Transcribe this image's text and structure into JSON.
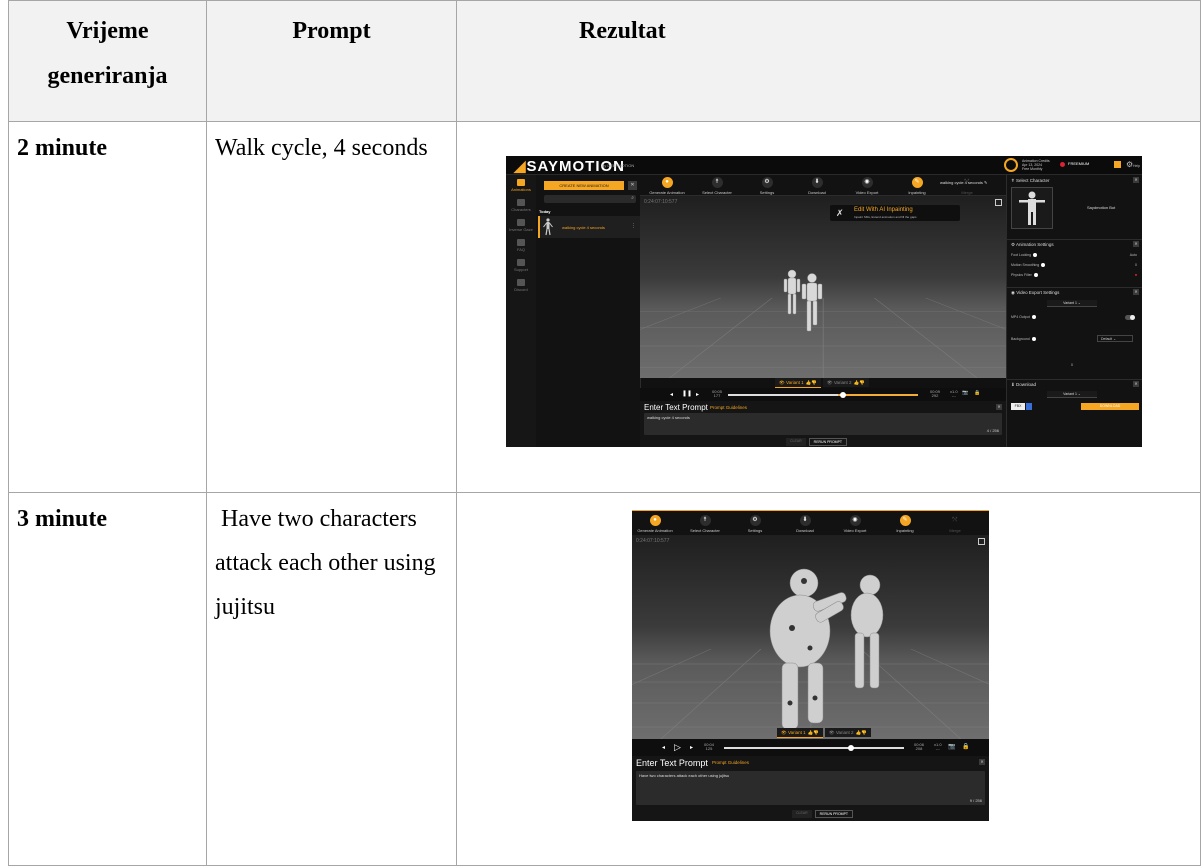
{
  "table": {
    "headers": {
      "col1_line1": "Vrijeme",
      "col1_line2": "generiranja",
      "col2": "Prompt",
      "col3": "Rezultat"
    },
    "rows": [
      {
        "time": "2 minute",
        "prompt": "Walk cycle, 4 seconds"
      },
      {
        "time": "3 minute",
        "prompt": " Have two characters attack each other using jujitsu"
      }
    ]
  },
  "shot1": {
    "logo": "SAYMOTION",
    "logo_by": "by DEEPMOTION",
    "credits": {
      "label": "Animation Credits",
      "renew": "Apr 13, 2024",
      "period": "Free Monthly",
      "plan": "FREEMIUM",
      "help": "Help"
    },
    "rail": [
      {
        "label": "Animations",
        "icon": "plus-icon",
        "active": true
      },
      {
        "label": "Characters",
        "icon": "person-icon",
        "active": false
      },
      {
        "label": "Inverse Gaze",
        "icon": "gamepad-icon",
        "active": false
      },
      {
        "label": "FAQ",
        "icon": "book-icon",
        "active": false
      },
      {
        "label": "Support",
        "icon": "gear-icon",
        "active": false
      },
      {
        "label": "Discord",
        "icon": "chat-icon",
        "active": false
      }
    ],
    "create_new": "CREATE NEW ANIMATION",
    "today": "Today",
    "history_item": "walking cycle 4 seconds",
    "toolbar": [
      {
        "label": "Generate Animation",
        "icon": "lightbulb-icon",
        "state": "hl"
      },
      {
        "label": "Select Character",
        "icon": "figure-icon",
        "state": "normal"
      },
      {
        "label": "Settings",
        "icon": "gear-icon",
        "state": "normal"
      },
      {
        "label": "Download",
        "icon": "download-icon",
        "state": "normal"
      },
      {
        "label": "Video Export",
        "icon": "record-icon",
        "state": "normal"
      },
      {
        "label": "Inpainting",
        "icon": "inpaint-icon",
        "state": "hl"
      },
      {
        "label": "Merge",
        "icon": "merge-icon",
        "state": "dim"
      }
    ],
    "title": "walking cycle 4 seconds",
    "timestamp": "0:24:07:10:577",
    "banner_title": "Edit With AI Inpainting",
    "banner_sub": "Inpaint SMs, Extend animation and fill the gaps",
    "variant1": "Variant 1",
    "variant2": "Variant 2",
    "time_cur": "00:05",
    "frame_cur": "177",
    "time_end": "00:09",
    "frame_end": "292",
    "fps_top": "x1.0",
    "fps_bot": "---",
    "prompt_title": "Enter Text Prompt",
    "prompt_guide": "Prompt Guidelines",
    "prompt_text": "walking cycle 4 seconds",
    "prompt_count": "4 / 256",
    "btn_clear": "CLEAR",
    "btn_rerun": "RERUN PROMPT",
    "panel": {
      "select_char": "Select Character",
      "char_name": "Saydmotion Bot",
      "anim_settings": "Animation Settings",
      "foot_locking": "Foot Locking",
      "foot_locking_val": "Auto",
      "motion_smoothing": "Motion Smoothing",
      "motion_smoothing_val": "0",
      "physics_filter": "Physics Filter",
      "video_export": "Video Export Settings",
      "variant_select": "Variant 1",
      "mp4_output": "MP4 Output",
      "background": "Background",
      "background_val": "Default",
      "background_num": "0",
      "download": "Download",
      "download_variant": "Variant 1",
      "format": "FBX",
      "download_btn": "DOWNLOAD"
    }
  },
  "shot2": {
    "toolbar": [
      {
        "label": "Generate Animation",
        "icon": "lightbulb-icon",
        "state": "hl"
      },
      {
        "label": "Select Character",
        "icon": "figure-icon",
        "state": "normal"
      },
      {
        "label": "Settings",
        "icon": "gear-icon",
        "state": "normal"
      },
      {
        "label": "Download",
        "icon": "download-icon",
        "state": "normal"
      },
      {
        "label": "Video Export",
        "icon": "record-icon",
        "state": "normal"
      },
      {
        "label": "Inpainting",
        "icon": "inpaint-icon",
        "state": "hl"
      },
      {
        "label": "Merge",
        "icon": "merge-icon",
        "state": "dim"
      }
    ],
    "timestamp": "0:24:07:10:577",
    "variant1": "Variant 1",
    "variant2": "Variant 2",
    "time_cur": "00:04",
    "frame_cur": "125",
    "time_end": "00:06",
    "frame_end": "208",
    "fps_top": "x1.0",
    "fps_bot": "---",
    "prompt_title": "Enter Text Prompt",
    "prompt_guide": "Prompt Guidelines",
    "prompt_text": "Have two characters attack each other using jujitsu",
    "prompt_count": "9 / 256",
    "btn_clear": "CLEAR",
    "btn_rerun": "RERUN PROMPT"
  },
  "colors": {
    "accent": "#f5a623",
    "border": "#a6a6a6",
    "header_bg": "#f2f2f2"
  }
}
